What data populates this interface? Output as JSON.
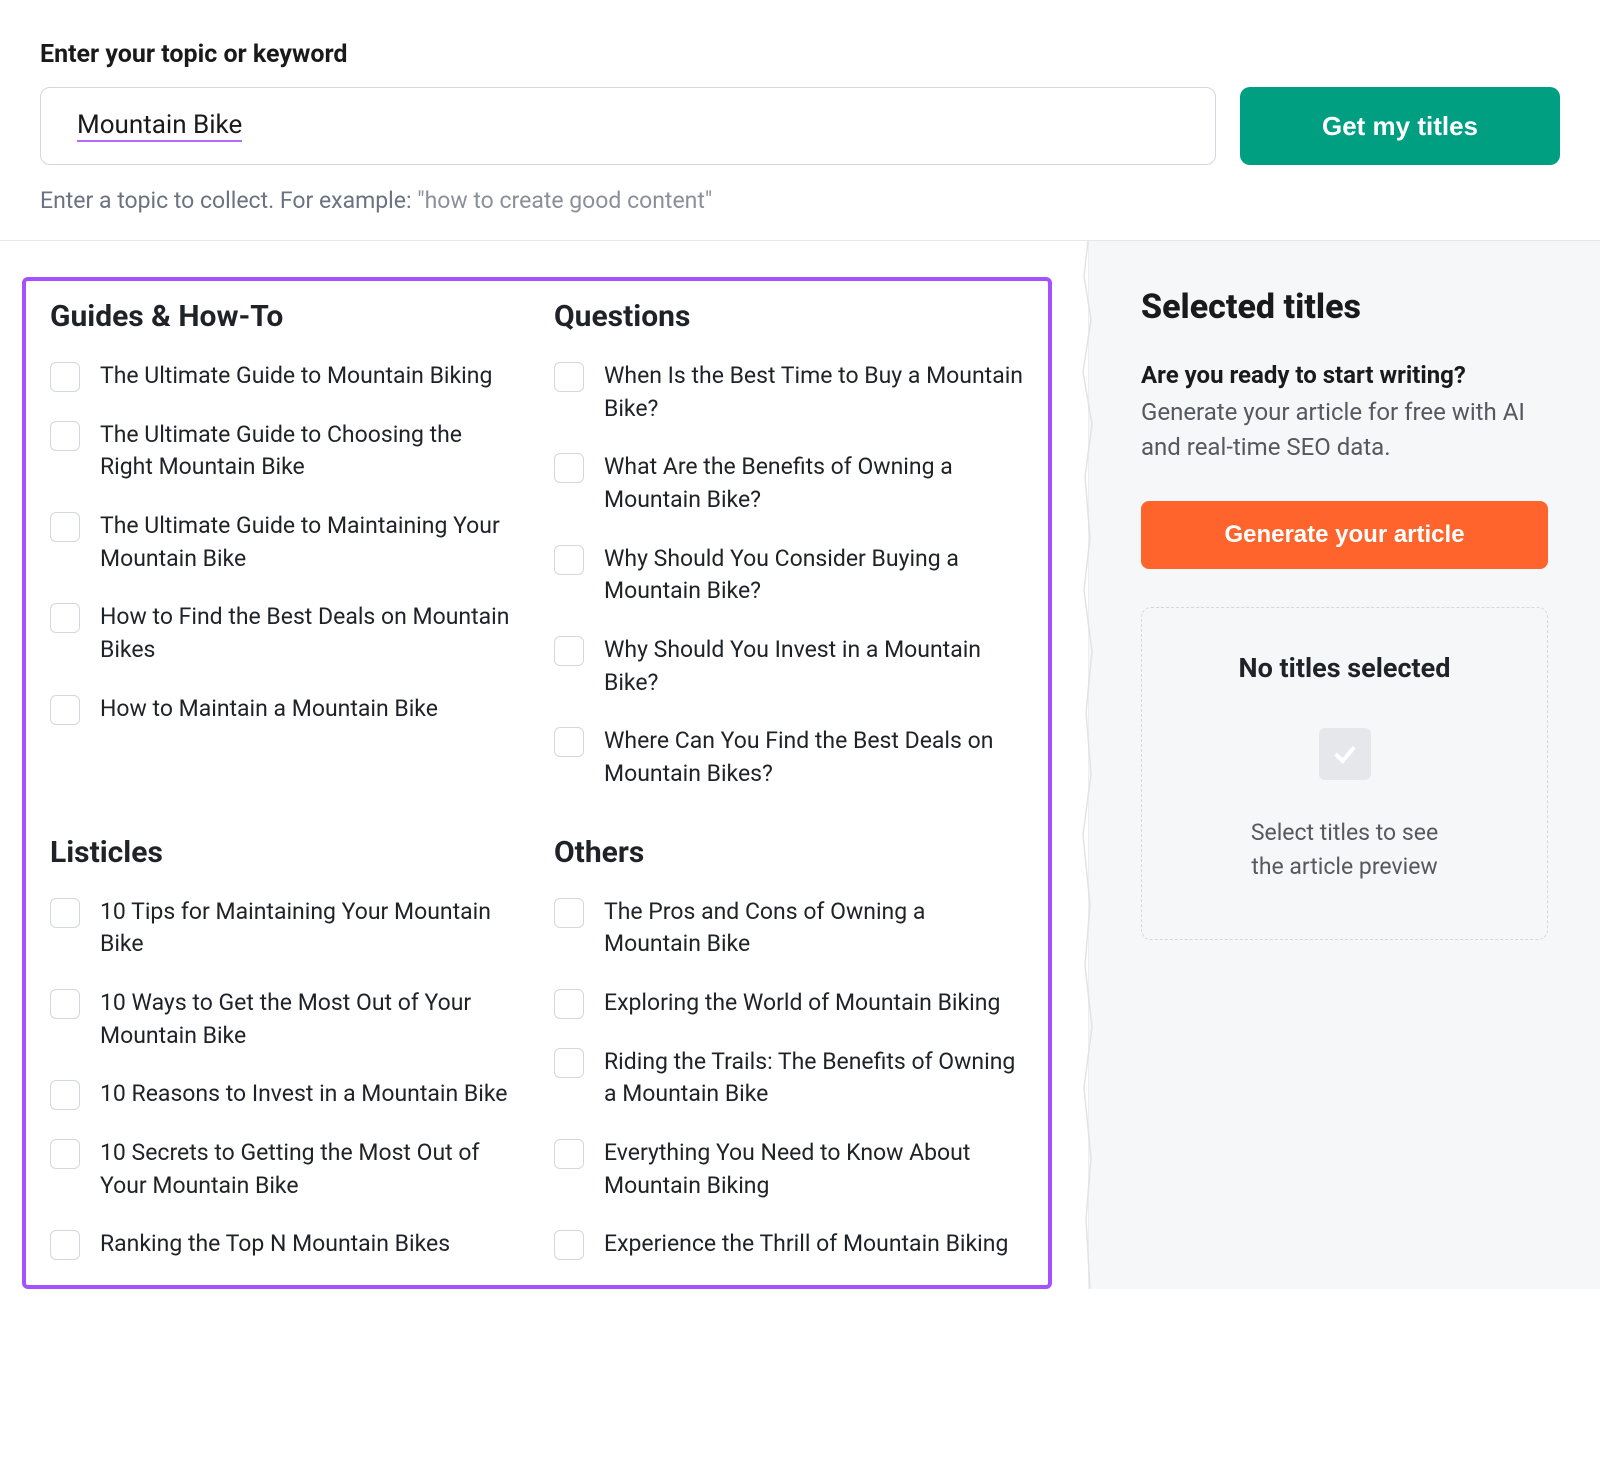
{
  "search": {
    "label": "Enter your topic or keyword",
    "value": "Mountain Bike",
    "button": "Get my titles",
    "hint_prefix": "Enter a topic to collect. For example: ",
    "hint_example": "\"how to create good content\""
  },
  "categories": [
    {
      "heading": "Guides & How-To",
      "items": [
        "The Ultimate Guide to Mountain Biking",
        "The Ultimate Guide to Choosing the Right Mountain Bike",
        "The Ultimate Guide to Maintaining Your Mountain Bike",
        "How to Find the Best Deals on Mountain Bikes",
        "How to Maintain a Mountain Bike"
      ]
    },
    {
      "heading": "Questions",
      "items": [
        "When Is the Best Time to Buy a Mountain Bike?",
        "What Are the Benefits of Owning a Mountain Bike?",
        "Why Should You Consider Buying a Mountain Bike?",
        "Why Should You Invest in a Mountain Bike?",
        "Where Can You Find the Best Deals on Mountain Bikes?"
      ]
    },
    {
      "heading": "Listicles",
      "items": [
        "10 Tips for Maintaining Your Mountain Bike",
        "10 Ways to Get the Most Out of Your Mountain Bike",
        "10 Reasons to Invest in a Mountain Bike",
        "10 Secrets to Getting the Most Out of Your Mountain Bike",
        "Ranking the Top N Mountain Bikes"
      ]
    },
    {
      "heading": "Others",
      "items": [
        "The Pros and Cons of Owning a Mountain Bike",
        "Exploring the World of Mountain Biking",
        "Riding the Trails: The Benefits of Owning a Mountain Bike",
        "Everything You Need to Know About Mountain Biking",
        "Experience the Thrill of Mountain Biking"
      ]
    }
  ],
  "sidebar": {
    "heading": "Selected titles",
    "ready_heading": "Are you ready to start writing?",
    "ready_sub": "Generate your article for free with AI and real-time SEO data.",
    "generate_button": "Generate your article",
    "empty": {
      "title": "No titles selected",
      "line1": "Select titles to see",
      "line2": "the article preview"
    }
  }
}
